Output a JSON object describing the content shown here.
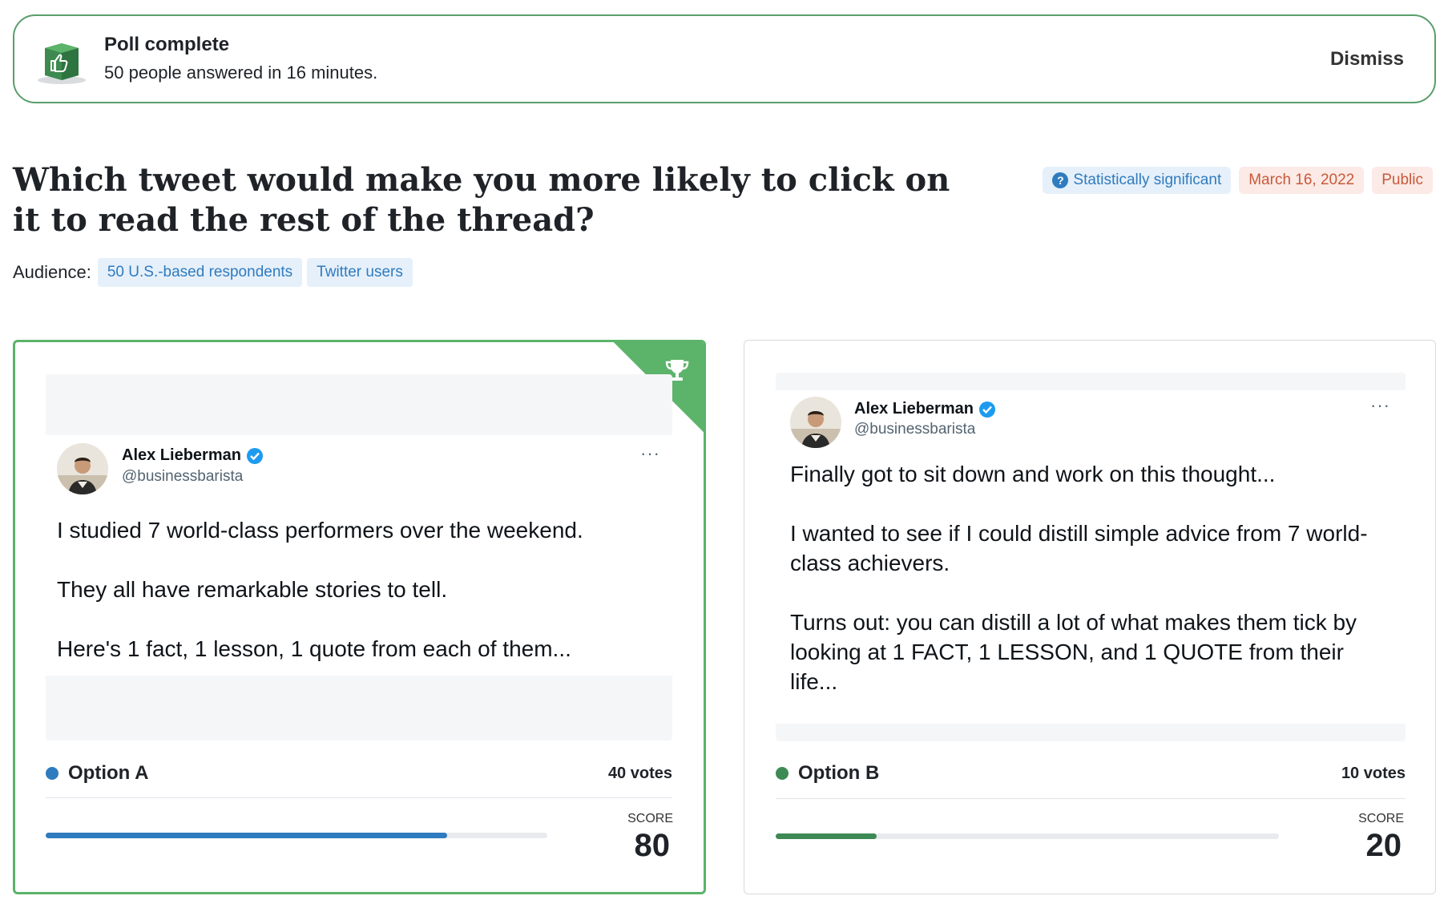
{
  "banner": {
    "title": "Poll complete",
    "subtitle": "50 people answered in 16 minutes.",
    "dismiss_label": "Dismiss",
    "icon": "thumbs-up-box-icon"
  },
  "question": {
    "text": "Which tweet would make you more likely to click on it to read the rest of the thread?",
    "tags": {
      "significance": "Statistically significant",
      "date": "March 16, 2022",
      "visibility": "Public"
    },
    "audience_label": "Audience:",
    "audience_chips": [
      "50 U.S.-based respondents",
      "Twitter users"
    ]
  },
  "options": [
    {
      "label": "Option A",
      "votes": "40 votes",
      "score_label": "SCORE",
      "score": "80",
      "score_fraction": 0.8,
      "winner": true,
      "color": "#2f7bbf",
      "tweet": {
        "author": "Alex Lieberman",
        "handle": "@businessbarista",
        "more": "···",
        "paragraphs": [
          "I studied 7 world-class performers over the weekend.",
          "They all have remarkable stories to tell.",
          "Here's 1 fact, 1 lesson, 1 quote from each of them..."
        ]
      }
    },
    {
      "label": "Option B",
      "votes": "10 votes",
      "score_label": "SCORE",
      "score": "20",
      "score_fraction": 0.2,
      "winner": false,
      "color": "#3d8a55",
      "tweet": {
        "author": "Alex Lieberman",
        "handle": "@businessbarista",
        "more": "···",
        "paragraphs": [
          "Finally got to sit down and work on this thought...",
          "I wanted to see if I could distill simple advice from 7 world-class achievers.",
          "Turns out: you can distill a lot of what makes them tick by looking at 1 FACT, 1 LESSON, and 1 QUOTE from their life..."
        ]
      }
    }
  ],
  "colors": {
    "accent_green": "#5cb36a",
    "link_blue": "#2f7bbf",
    "tag_orange": "#c9593a",
    "verified_blue": "#1d9bf0"
  }
}
